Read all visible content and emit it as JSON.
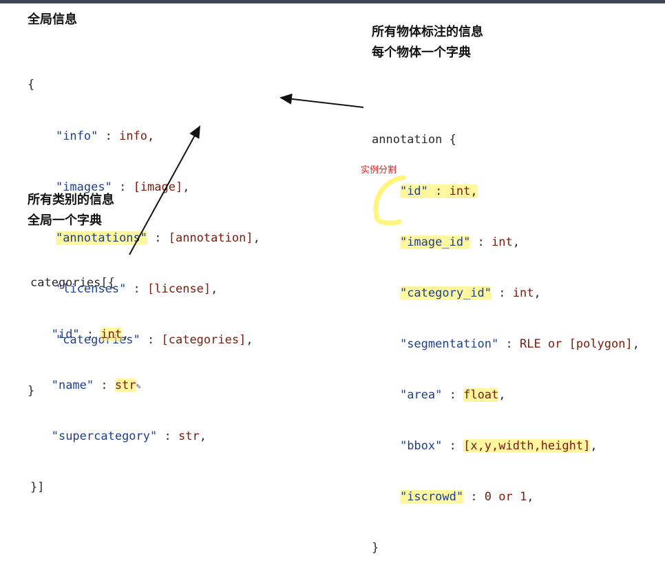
{
  "headings": {
    "global_info": "全局信息",
    "object_annotations": "所有物体标注的信息",
    "per_object_dict": "每个物体一个字典",
    "all_categories": "所有类别的信息",
    "global_dict": "全局一个字典"
  },
  "global_block": {
    "open": "{",
    "lines": [
      {
        "key": "\"info\"",
        "sep": " : ",
        "value": "info",
        "tail": ","
      },
      {
        "key": "\"images\"",
        "sep": " : ",
        "value": "[image]",
        "tail": ","
      },
      {
        "key": "\"annotations\"",
        "sep": " : ",
        "value": "[annotation]",
        "tail": ","
      },
      {
        "key": "\"licenses\"",
        "sep": " : ",
        "value": "[license]",
        "tail": ","
      },
      {
        "key": "\"categories\"",
        "sep": " : ",
        "value": "[categories]",
        "tail": ","
      }
    ],
    "close": "}"
  },
  "annotation_block": {
    "open": "annotation {",
    "lines": [
      {
        "key": "\"id\"",
        "sep": " : ",
        "value": "int",
        "tail": ","
      },
      {
        "key": "\"image_id\"",
        "sep": " : ",
        "value": "int",
        "tail": ","
      },
      {
        "key": "\"category_id\"",
        "sep": " : ",
        "value": "int",
        "tail": ","
      },
      {
        "key": "\"segmentation\"",
        "sep": " : ",
        "value": "RLE or [polygon]",
        "tail": ","
      },
      {
        "key": "\"area\"",
        "sep": " : ",
        "value": "float",
        "tail": ","
      },
      {
        "key": "\"bbox\"",
        "sep": " : ",
        "value": "[x,y,width,height]",
        "tail": ","
      },
      {
        "key": "\"iscrowd\"",
        "sep": " : ",
        "value": "0 or 1",
        "tail": ","
      }
    ],
    "close": "}",
    "handwritten_note": "实例分割"
  },
  "categories_block": {
    "open": "categories[{",
    "lines": [
      {
        "key": "\"id\"",
        "sep": " : ",
        "value": "int",
        "tail": ","
      },
      {
        "key": "\"name\"",
        "sep": " : ",
        "value": "str",
        "tail": ""
      },
      {
        "key": "\"supercategory\"",
        "sep": " : ",
        "value": "str",
        "tail": ","
      }
    ],
    "close": "}]"
  },
  "colors": {
    "key": "#1c3f8e",
    "value": "#7a1a0a",
    "highlight": "#fff050",
    "note": "#e02020",
    "arrow": "#111111"
  }
}
